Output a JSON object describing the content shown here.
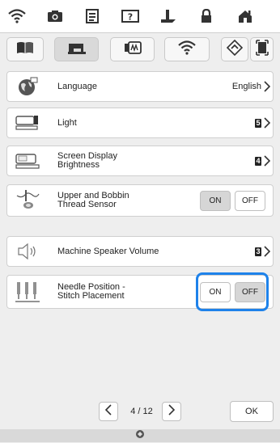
{
  "topbar": {
    "icons": [
      "wifi-icon",
      "camera-icon",
      "document-icon",
      "help-icon",
      "needle-foot-icon",
      "lock-icon",
      "home-icon"
    ]
  },
  "tabs": {
    "icons": [
      "book-icon",
      "sewing-machine-icon",
      "embroidery-icon",
      "wifi-icon"
    ],
    "active_index": 1
  },
  "rows": [
    {
      "name": "language",
      "label": "Language",
      "value": "English"
    },
    {
      "name": "light",
      "label": "Light",
      "value": "5"
    },
    {
      "name": "screen-display-brightness",
      "label": "Screen Display\nBrightness",
      "value": "4"
    },
    {
      "name": "upper-and-bobbin-thread-sensor",
      "label": "Upper and Bobbin\nThread Sensor",
      "on": "ON",
      "off": "OFF",
      "selected": "ON"
    },
    {
      "name": "machine-speaker-volume",
      "label": "Machine Speaker Volume",
      "value": "3"
    },
    {
      "name": "needle-position-stitch-placement",
      "label": "Needle Position -\nStitch Placement",
      "on": "ON",
      "off": "OFF",
      "selected": "OFF"
    }
  ],
  "pager": {
    "page_label": "4 / 12"
  },
  "ok_label": "OK",
  "colors": {
    "highlight": "#1e82ea",
    "selected_segment": "#d6d6d6"
  }
}
